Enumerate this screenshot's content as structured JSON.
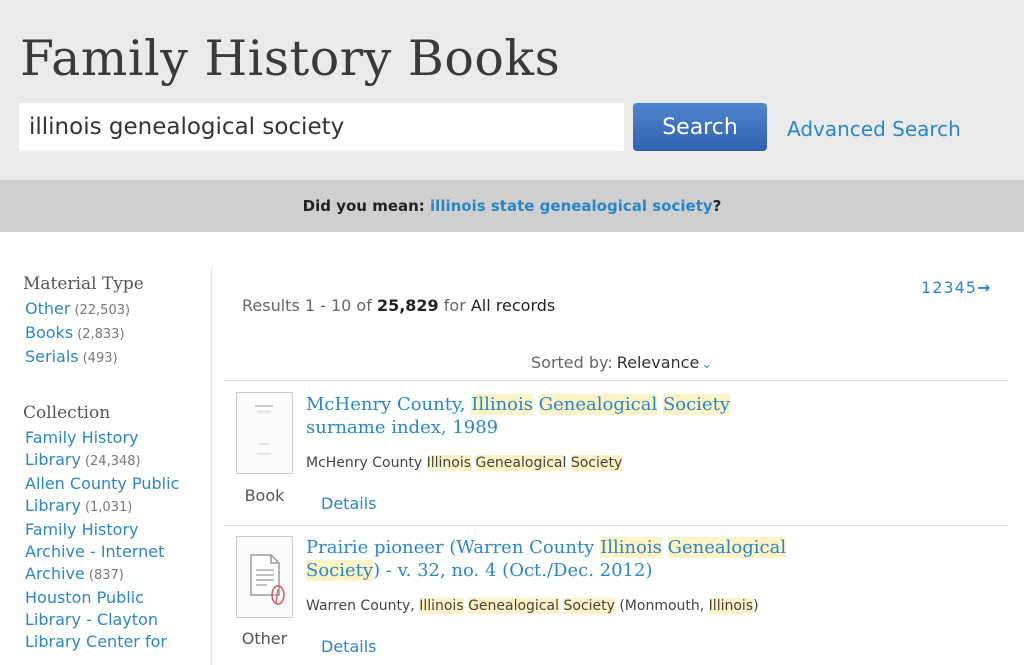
{
  "header": {
    "title": "Family History Books",
    "search_value": "illinois genealogical society",
    "search_button": "Search",
    "advanced_link": "Advanced Search"
  },
  "suggestion": {
    "prefix": "Did you mean: ",
    "link": "illinois state genealogical society",
    "suffix": "?"
  },
  "sidebar": {
    "material_type": {
      "heading": "Material Type",
      "items": [
        {
          "label": "Other",
          "count": "(22,503)"
        },
        {
          "label": "Books",
          "count": "(2,833)"
        },
        {
          "label": "Serials",
          "count": "(493)"
        }
      ]
    },
    "collection": {
      "heading": "Collection",
      "items": [
        {
          "line1": "Family History",
          "line2": "Library",
          "count": "(24,348)"
        },
        {
          "line1": "Allen County Public",
          "line2": "Library",
          "count": "(1,031)"
        },
        {
          "line1": "Family History",
          "line2": "Archive - Internet",
          "line3": "Archive",
          "count": "(837)"
        },
        {
          "line1": "Houston Public",
          "line2": "Library - Clayton",
          "line3": "Library Center for"
        }
      ]
    }
  },
  "results": {
    "summary_prefix": "Results ",
    "range": "1 - 10",
    "of": " of ",
    "total": "25,829",
    "for": " for ",
    "scope": "All records",
    "pager": [
      "1",
      "2",
      "3",
      "4",
      "5"
    ],
    "pager_next": "→",
    "sort_label": "Sorted by:",
    "sort_value": "Relevance",
    "details_label": "Details",
    "items": [
      {
        "type": "Book",
        "title_a": "McHenry County, ",
        "title_b": "Illinois",
        "title_c": " ",
        "title_d": "Genealogical",
        "title_e": " ",
        "title_f": "Society",
        "title_g": " surname index, 1989",
        "author_a": "McHenry County ",
        "author_b": "Illinois",
        "author_c": " ",
        "author_d": "Genealogical",
        "author_e": " ",
        "author_f": "Society",
        "author_g": ""
      },
      {
        "type": "Other",
        "title_a": "Prairie pioneer (Warren County ",
        "title_b": "Illinois",
        "title_c": " ",
        "title_d": "Genealogical",
        "title_e": " ",
        "title_f": "Society",
        "title_g": ") - v. 32, no. 4 (Oct./Dec. 2012)",
        "author_a": "Warren County, ",
        "author_b": "Illinois",
        "author_c": " ",
        "author_d": "Genealogical",
        "author_e": " ",
        "author_f": "Society",
        "author_g": " (Monmouth, ",
        "author_h": "Illinois",
        "author_i": ")"
      }
    ]
  }
}
